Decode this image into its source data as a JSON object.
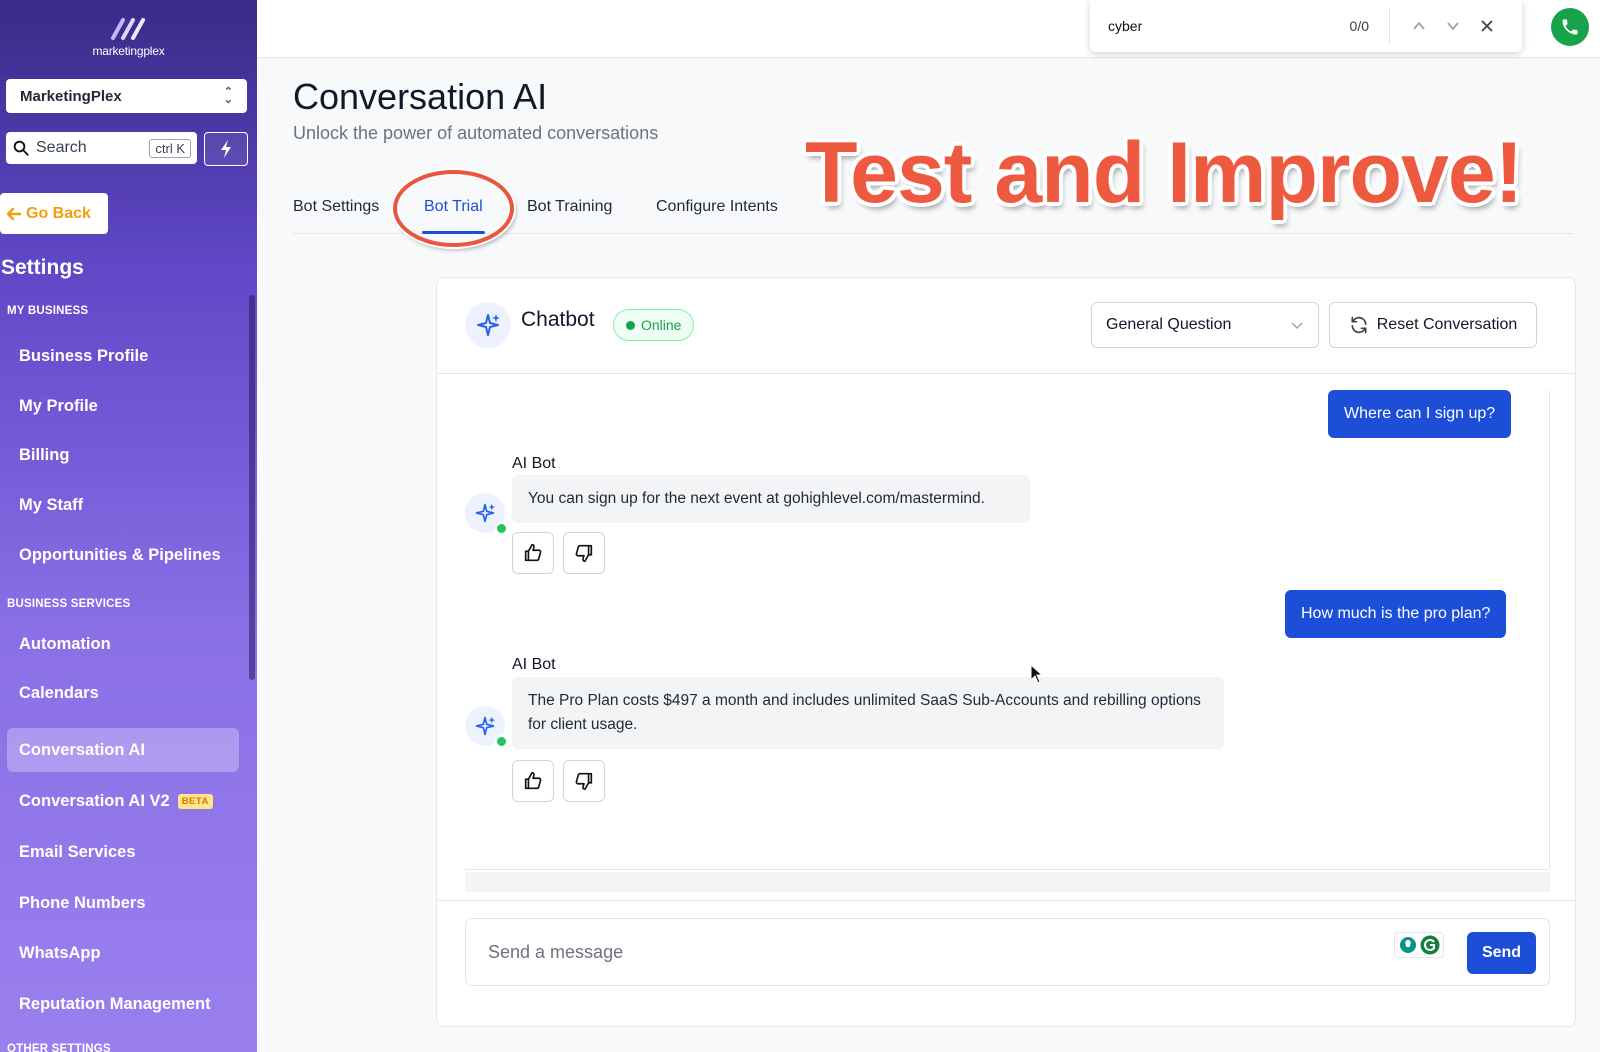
{
  "sidebar": {
    "logo_text": "marketingplex",
    "account_name": "MarketingPlex",
    "search_label": "Search",
    "search_shortcut": "ctrl K",
    "go_back_label": "Go Back",
    "settings_title": "Settings",
    "sections": {
      "my_business": "MY BUSINESS",
      "business_services": "BUSINESS SERVICES",
      "other_settings": "OTHER SETTINGS"
    },
    "items": [
      {
        "label": "Business Profile"
      },
      {
        "label": "My Profile"
      },
      {
        "label": "Billing"
      },
      {
        "label": "My Staff"
      },
      {
        "label": "Opportunities & Pipelines"
      },
      {
        "label": "Automation"
      },
      {
        "label": "Calendars"
      },
      {
        "label": "Conversation AI",
        "active": true
      },
      {
        "label": "Conversation AI V2",
        "badge": "BETA"
      },
      {
        "label": "Email Services"
      },
      {
        "label": "Phone Numbers"
      },
      {
        "label": "WhatsApp"
      },
      {
        "label": "Reputation Management"
      }
    ]
  },
  "find_bar": {
    "query": "cyber",
    "count": "0/0"
  },
  "header": {
    "title": "Conversation AI",
    "subtitle": "Unlock the power of automated conversations",
    "overlay": "Test and Improve!"
  },
  "tabs": [
    {
      "label": "Bot Settings"
    },
    {
      "label": "Bot Trial",
      "active": true
    },
    {
      "label": "Bot Training"
    },
    {
      "label": "Configure Intents"
    }
  ],
  "chat": {
    "bot_name": "Chatbot",
    "status": "Online",
    "intent_selected": "General Question",
    "reset_label": "Reset Conversation",
    "messages": [
      {
        "from": "user",
        "text": "Where can I sign up?"
      },
      {
        "from": "bot",
        "sender": "AI Bot",
        "text": "You can sign up for the next event at gohighlevel.com/mastermind."
      },
      {
        "from": "user",
        "text": "How much is the pro plan?"
      },
      {
        "from": "bot",
        "sender": "AI Bot",
        "text": "The Pro Plan costs $497 a month and includes unlimited SaaS Sub-Accounts and rebilling options for client usage."
      }
    ],
    "input_placeholder": "Send a message",
    "send_label": "Send"
  },
  "colors": {
    "brand_purple": "#5f47c7",
    "primary_blue": "#1d4ed8",
    "online_green": "#16a34a",
    "annotation_red": "#ee5a3f",
    "go_back_orange": "#f59e0b"
  }
}
